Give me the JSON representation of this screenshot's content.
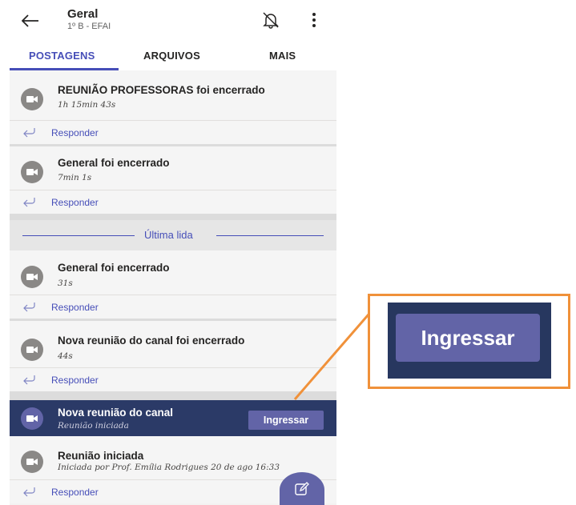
{
  "header": {
    "title": "Geral",
    "subtitle": "1º B - EFAI"
  },
  "tabs": [
    {
      "label": "POSTAGENS",
      "active": true
    },
    {
      "label": "ARQUIVOS",
      "active": false
    },
    {
      "label": "MAIS",
      "active": false
    }
  ],
  "reply_label": "Responder",
  "posts": [
    {
      "title": "REUNIÃO PROFESSORAS foi encerrado",
      "subtitle": "1h 15min 43s"
    },
    {
      "title": "General foi encerrado",
      "subtitle": "7min 1s"
    },
    {
      "title": "General foi encerrado",
      "subtitle": "31s"
    },
    {
      "title": "Nova reunião do canal foi encerrado",
      "subtitle": "44s"
    }
  ],
  "last_read_label": "Última lida",
  "active_meeting": {
    "title": "Nova reunião do canal",
    "subtitle": "Reunião iniciada",
    "join_label": "Ingressar"
  },
  "last_post": {
    "title": "Reunião iniciada",
    "subtitle": "Iniciada por Prof. Emília Rodrigues   20 de ago 16:33"
  },
  "callout": {
    "join_label": "Ingressar",
    "border_color": "#f0913a"
  },
  "colors": {
    "accent": "#464eb8",
    "button": "#6264a7",
    "active_bg": "#2b3a67"
  }
}
